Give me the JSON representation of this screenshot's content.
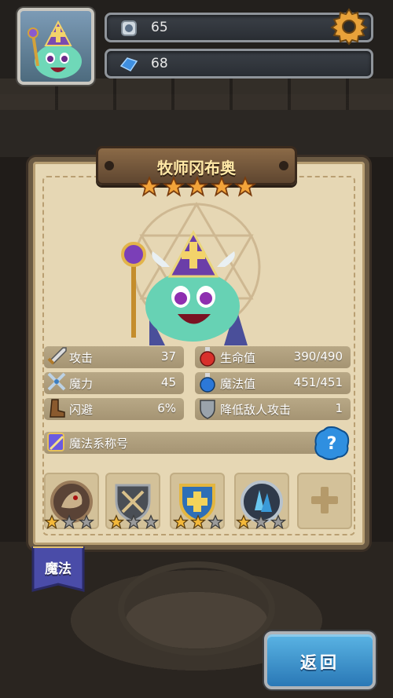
{
  "top_bar": {
    "gems_value": "65",
    "crystals_value": "68",
    "gear_icon": "gear-icon"
  },
  "hero": {
    "name": "牧师冈布奥",
    "star_rating": 5,
    "star_max": 5
  },
  "stats": {
    "attack_label": "攻击",
    "attack_value": "37",
    "magic_label": "魔力",
    "magic_value": "45",
    "dodge_label": "闪避",
    "dodge_value": "6%",
    "hp_label": "生命值",
    "hp_value": "390/490",
    "mp_label": "魔法值",
    "mp_value": "451/451",
    "reduce_label": "降低敌人攻击",
    "reduce_value": "1"
  },
  "title_row": {
    "label": "魔法系称号"
  },
  "skills": [
    {
      "name": "beast-skill-icon",
      "stars": 1,
      "max": 3
    },
    {
      "name": "cross-shield-skill-icon",
      "stars": 1,
      "max": 3
    },
    {
      "name": "holy-shield-skill-icon",
      "stars": 2,
      "max": 3
    },
    {
      "name": "crystal-skill-icon",
      "stars": 1,
      "max": 3
    }
  ],
  "tab": {
    "label": "魔法"
  },
  "back_button": {
    "label": "返回"
  },
  "colors": {
    "panel": "#e6d7b4",
    "star_gold": "#f3a43a",
    "star_gray": "#9a9a9a",
    "accent_blue": "#2a78b6"
  }
}
